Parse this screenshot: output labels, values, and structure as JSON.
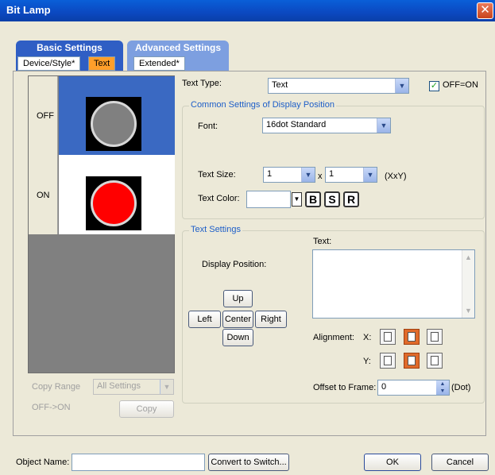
{
  "window": {
    "title": "Bit Lamp",
    "close_glyph": "✕"
  },
  "tabs": {
    "basic_label": "Basic Settings",
    "advanced_label": "Advanced Settings",
    "device_style": "Device/Style*",
    "text": "Text",
    "extended": "Extended*"
  },
  "preview": {
    "off_label": "OFF",
    "on_label": "ON",
    "off_color": "#808080",
    "on_color": "#ff0000",
    "selected_color": "#3a69c2"
  },
  "copy": {
    "range_label": "Copy Range",
    "range_value": "All Settings",
    "off_on_label": "OFF->ON",
    "copy_button": "Copy"
  },
  "text_type": {
    "label": "Text Type:",
    "value": "Text",
    "off_on_label": "OFF=ON",
    "off_on_checked": true
  },
  "common": {
    "group_title": "Common Settings of Display Position",
    "font_label": "Font:",
    "font_value": "16dot Standard",
    "size_label": "Text Size:",
    "size_x": "1",
    "size_sep": "x",
    "size_y": "1",
    "size_unit": "(XxY)",
    "color_label": "Text Color:",
    "bold": "B",
    "shadow": "S",
    "reverse": "R"
  },
  "text_settings": {
    "group_title": "Text Settings",
    "display_position_label": "Display Position:",
    "up": "Up",
    "left": "Left",
    "center": "Center",
    "right": "Right",
    "down": "Down",
    "text_label": "Text:",
    "text_value": "",
    "alignment_label": "Alignment:",
    "x_label": "X:",
    "y_label": "Y:",
    "offset_label": "Offset to Frame:",
    "offset_value": "0",
    "offset_unit": "(Dot)"
  },
  "footer": {
    "object_name_label": "Object Name:",
    "object_name_value": "",
    "convert_button": "Convert to Switch...",
    "ok": "OK",
    "cancel": "Cancel"
  }
}
